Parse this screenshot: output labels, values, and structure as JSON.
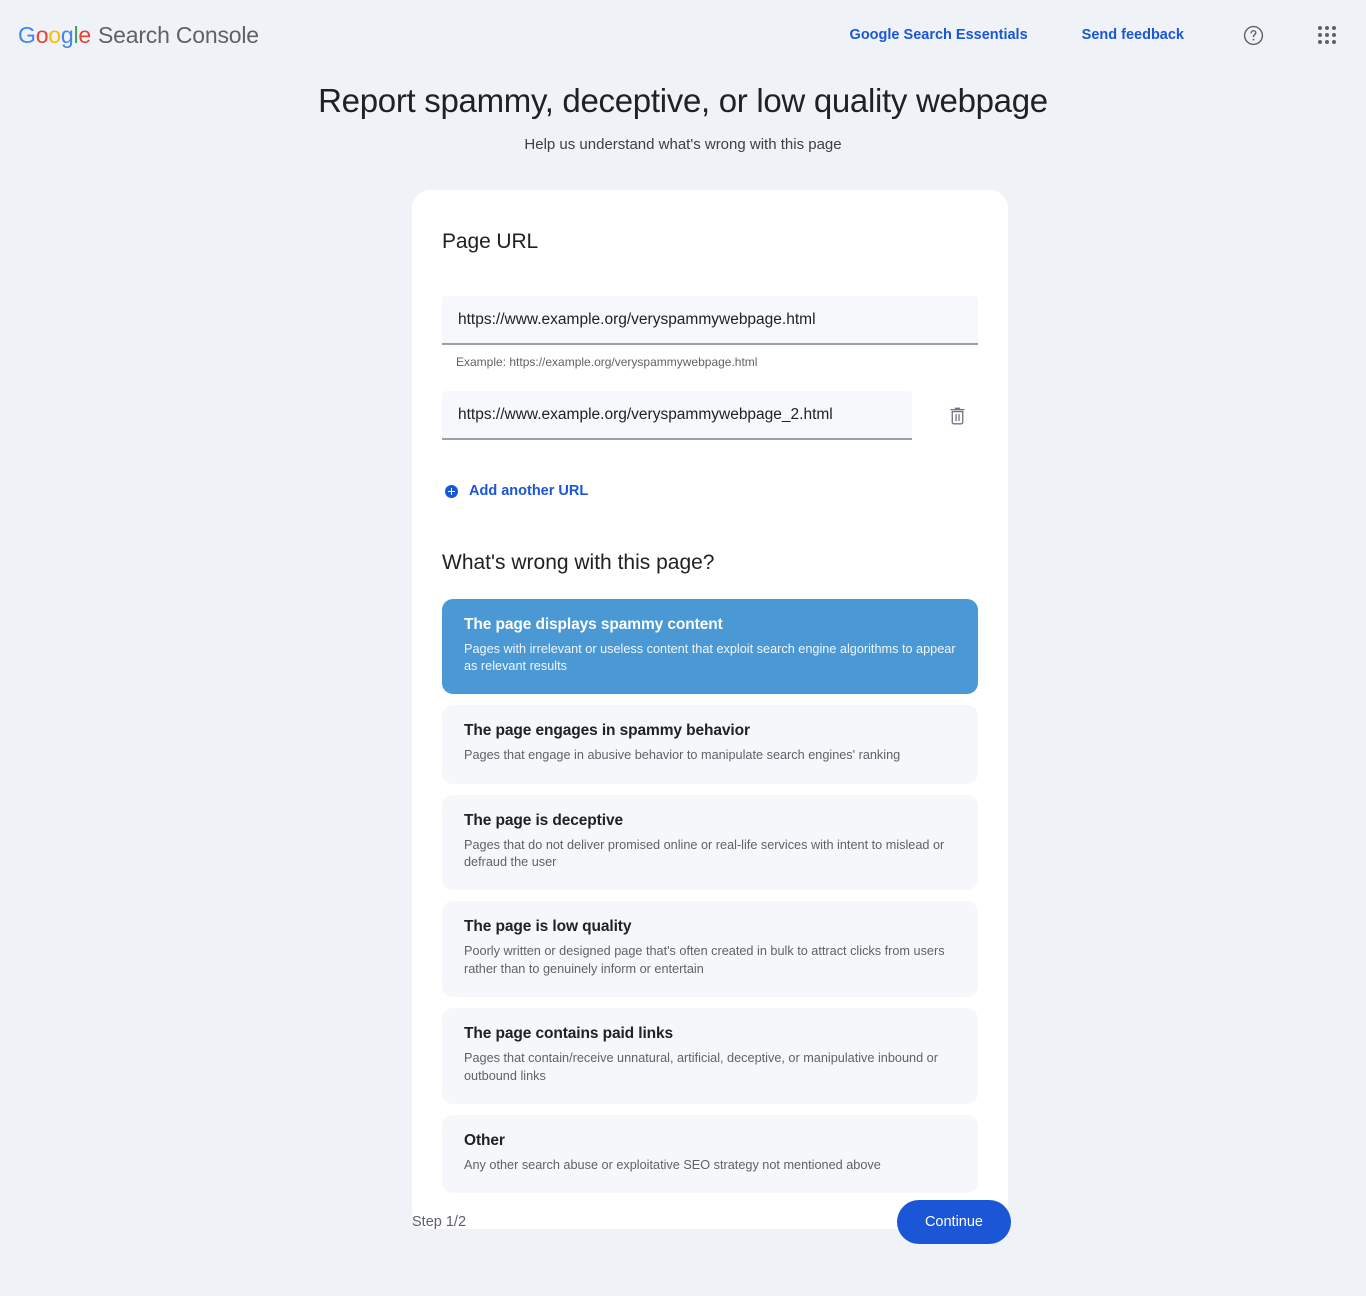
{
  "header": {
    "brand_google": "Google",
    "brand_product": "Search Console",
    "links": [
      {
        "label": "Google Search Essentials"
      },
      {
        "label": "Send feedback"
      }
    ],
    "help_icon": "help-circle-icon",
    "apps_icon": "apps-grid-icon"
  },
  "page": {
    "title": "Report spammy, deceptive, or low quality webpage",
    "subtitle": "Help us understand what's wrong with this page"
  },
  "url_section": {
    "title": "Page URL",
    "field_1": {
      "value": "https://www.example.org/veryspammywebpage.html",
      "placeholder": "https://example.org/veryspammywebpage.html"
    },
    "helper_text": "Example: https://example.org/veryspammywebpage.html",
    "field_2": {
      "value": "https://www.example.org/veryspammywebpage_2.html",
      "placeholder": "https://example.org/veryspammywebpage.html"
    },
    "delete_icon": "trash-icon",
    "add_another": {
      "label": "Add another URL",
      "icon": "plus-circle-icon"
    }
  },
  "question_section": {
    "title": "What's wrong with this page?",
    "options": [
      {
        "title": "The page displays spammy content",
        "description": "Pages with irrelevant or useless content that exploit search engine algorithms to appear as relevant results",
        "selected": true
      },
      {
        "title": "The page engages in spammy behavior",
        "description": "Pages that engage in abusive behavior to manipulate search engines' ranking",
        "selected": false
      },
      {
        "title": "The page is deceptive",
        "description": "Pages that do not deliver promised online or real-life services with intent to mislead or defraud the user",
        "selected": false
      },
      {
        "title": "The page is low quality",
        "description": "Poorly written or designed page that's often created in bulk to attract clicks from users rather than to genuinely inform or entertain",
        "selected": false
      },
      {
        "title": "The page contains paid links",
        "description": "Pages that contain/receive unnatural, artificial, deceptive, or manipulative inbound or outbound links",
        "selected": false
      },
      {
        "title": "Other",
        "description": "Any other search abuse or exploitative SEO strategy not mentioned above",
        "selected": false
      }
    ]
  },
  "footer": {
    "step_label": "Step 1/2",
    "continue_label": "Continue"
  },
  "colors": {
    "background": "#eff2f7",
    "card": "#ffffff",
    "accent_blue": "#1a56d6",
    "selected_option": "#4a98d4",
    "option_bg": "#f5f7fa",
    "field_bg": "#f6f8fb"
  }
}
